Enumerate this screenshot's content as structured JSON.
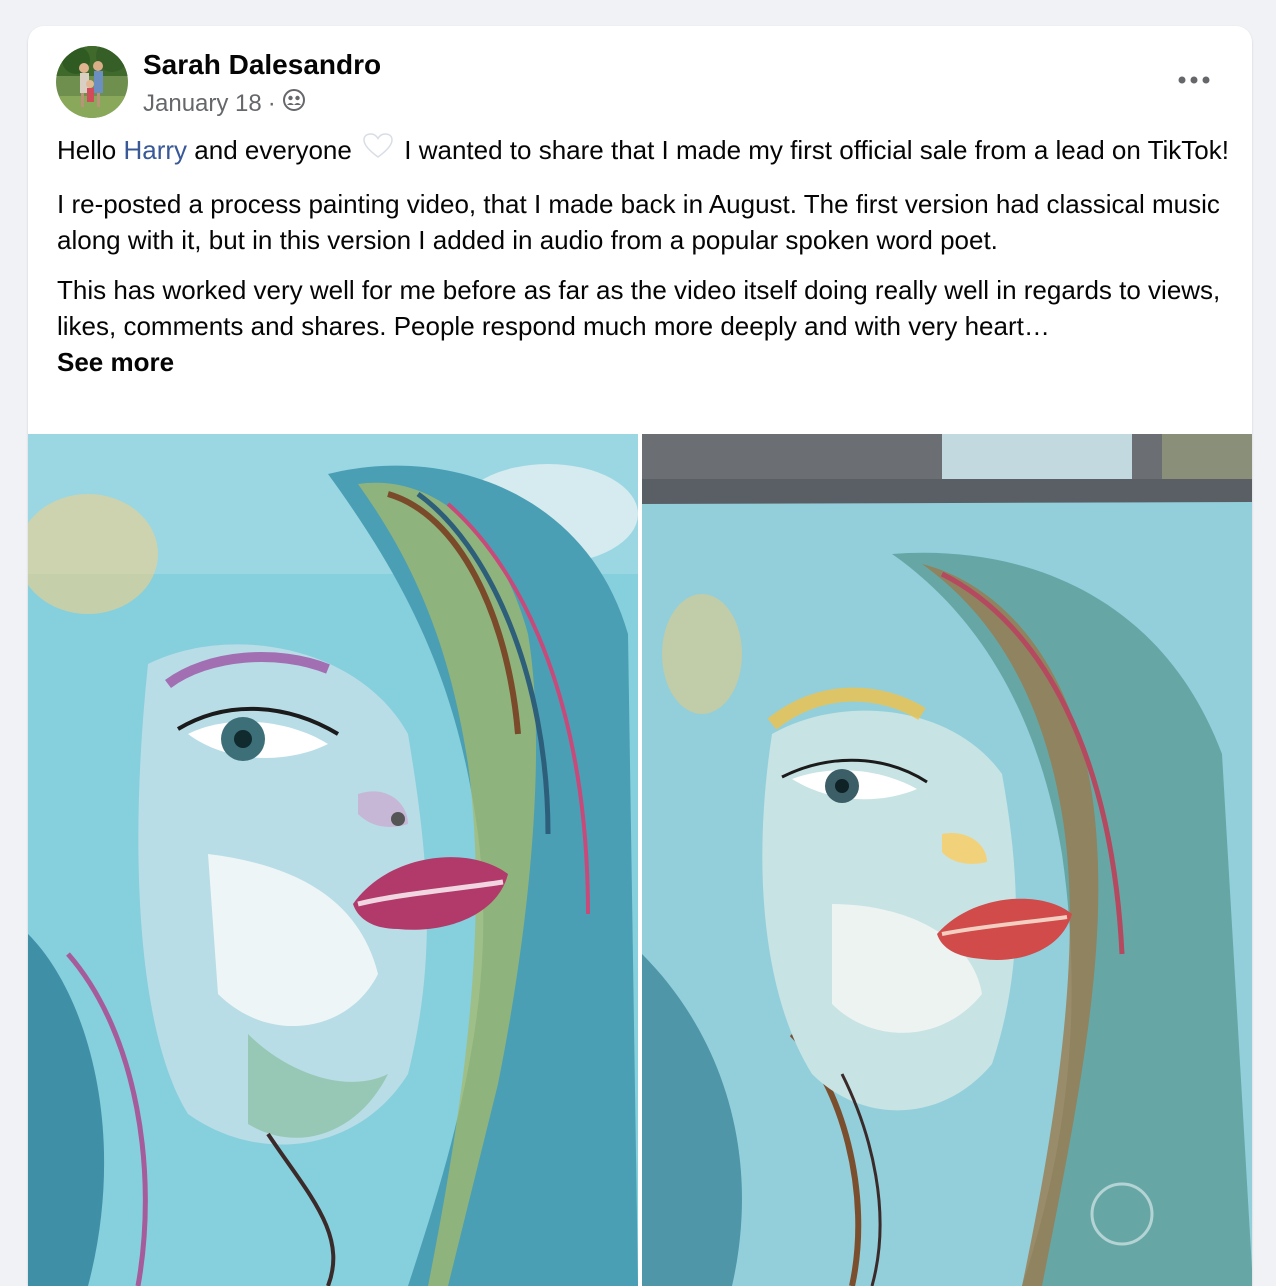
{
  "post": {
    "author": "Sarah Dalesandro",
    "date": "January 18",
    "separator": "·",
    "audience_icon": "friends-icon",
    "options_icon": "more-horizontal-icon",
    "body": {
      "p1_prefix": "Hello ",
      "mention": "Harry",
      "p1_mid": " and everyone ",
      "heart_icon": "white-heart-emoji",
      "p1_suffix": " I wanted to share that I made my first official sale from a lead on TikTok!",
      "p2": "I re-posted a process painting video, that I made back in August. The first version had classical music along with it, but in this version I added in audio from a popular spoken word poet.",
      "p3": "This has worked very well for me before as far as the video itself doing really well in regards to views, likes, comments and shares. People respond much more deeply and with very heart…",
      "see_more": "See more"
    },
    "photos": [
      {
        "name": "painting-closeup"
      },
      {
        "name": "painting-on-easel"
      }
    ]
  },
  "colors": {
    "page_bg": "#f0f2f5",
    "card_bg": "#ffffff",
    "link": "#385898",
    "secondary_text": "#65676b",
    "painting_teal": "#7ec9d8"
  }
}
